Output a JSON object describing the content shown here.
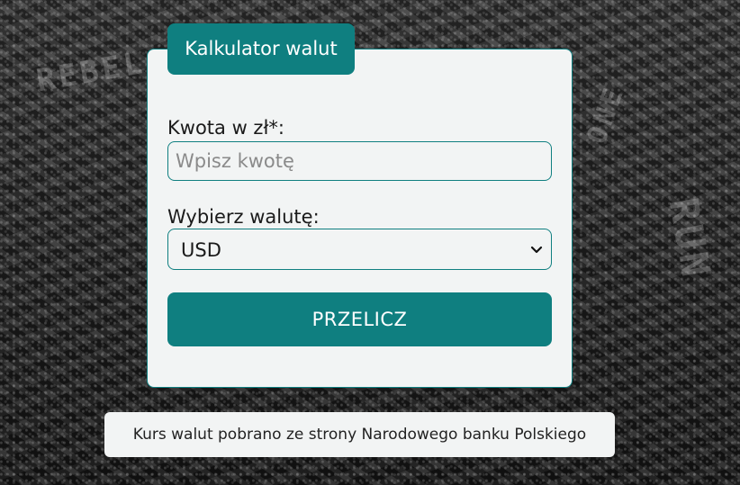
{
  "form": {
    "title": "Kalkulator walut",
    "amount_label": "Kwota w zł*:",
    "amount_placeholder": "Wpisz kwotę",
    "amount_value": "",
    "currency_label": "Wybierz walutę:",
    "currency_selected": "USD",
    "submit_label": "PRZELICZ"
  },
  "footer": {
    "note": "Kurs walut pobrano ze strony Narodowego banku Polskiego"
  },
  "icons": {
    "select_arrow": "chevron-down-icon"
  },
  "colors": {
    "accent": "#0f7f80",
    "card_bg": "#f2f4f4",
    "text": "#1a1a1a",
    "placeholder": "#8a8a8a"
  }
}
